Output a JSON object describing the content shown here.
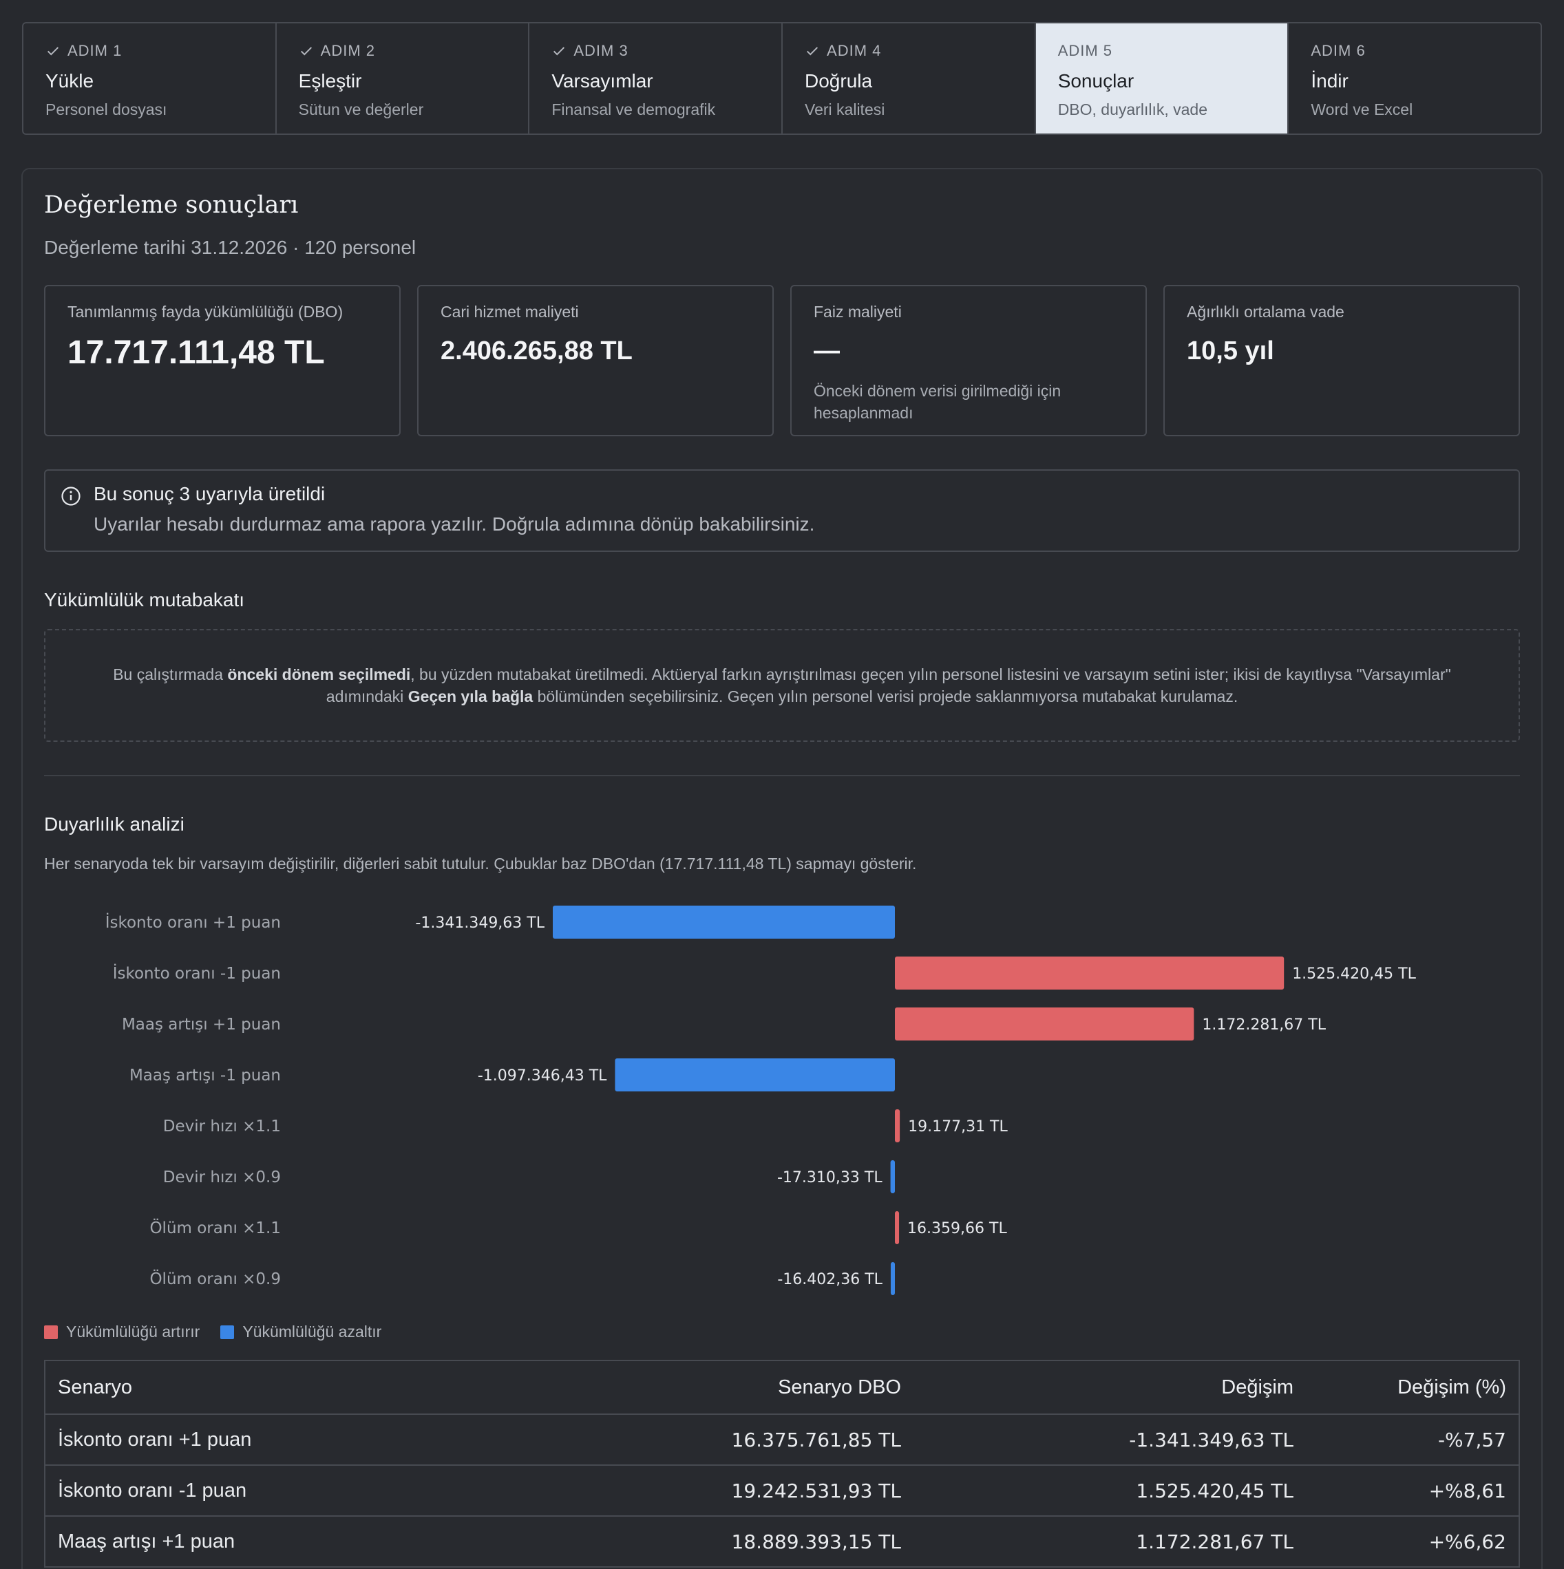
{
  "steps": [
    {
      "kicker": "ADIM 1",
      "title": "Yükle",
      "sub": "Personel dosyası",
      "done": true
    },
    {
      "kicker": "ADIM 2",
      "title": "Eşleştir",
      "sub": "Sütun ve değerler",
      "done": true
    },
    {
      "kicker": "ADIM 3",
      "title": "Varsayımlar",
      "sub": "Finansal ve demografik",
      "done": true
    },
    {
      "kicker": "ADIM 4",
      "title": "Doğrula",
      "sub": "Veri kalitesi",
      "done": true
    },
    {
      "kicker": "ADIM 5",
      "title": "Sonuçlar",
      "sub": "DBO, duyarlılık, vade",
      "done": false
    },
    {
      "kicker": "ADIM 6",
      "title": "İndir",
      "sub": "Word ve Excel",
      "done": false
    }
  ],
  "page": {
    "title": "Değerleme sonuçları",
    "meta": "Değerleme tarihi 31.12.2026 · 120 personel"
  },
  "stats": {
    "dbo": {
      "label": "Tanımlanmış fayda yükümlülüğü (DBO)",
      "value": "17.717.111,48 TL"
    },
    "service_cost": {
      "label": "Cari hizmet maliyeti",
      "value": "2.406.265,88 TL"
    },
    "interest_cost": {
      "label": "Faiz maliyeti",
      "value": "—",
      "note": "Önceki dönem verisi girilmediği için hesaplanmadı"
    },
    "duration": {
      "label": "Ağırlıklı ortalama vade",
      "value": "10,5 yıl"
    }
  },
  "warning": {
    "title": "Bu sonuç 3 uyarıyla üretildi",
    "detail": "Uyarılar hesabı durdurmaz ama rapora yazılır. Doğrula adımına dönüp bakabilirsiniz."
  },
  "reconciliation": {
    "title": "Yükümlülük mutabakatı",
    "text_1": "Bu çalıştırmada ",
    "bold_1": "önceki dönem seçilmedi",
    "text_2": ", bu yüzden mutabakat üretilmedi. Aktüeryal farkın ayrıştırılması geçen yılın personel listesini ve varsayım setini ister; ikisi de kayıtlıysa \"Varsayımlar\" adımındaki ",
    "bold_2": "Geçen yıla bağla",
    "text_3": " bölümünden seçebilirsiniz. Geçen yılın personel verisi projede saklanmıyorsa mutabakat kurulamaz."
  },
  "sensitivity": {
    "title": "Duyarlılık analizi",
    "description": "Her senaryoda tek bir varsayım değiştirilir, diğerleri sabit tutulur. Çubuklar baz DBO'dan (17.717.111,48 TL) sapmayı gösterir.",
    "legend": {
      "increase": "Yükümlülüğü artırır",
      "decrease": "Yükümlülüğü azaltır"
    },
    "colors": {
      "increase": "#e06467",
      "decrease": "#3a86e6"
    },
    "table_headers": {
      "scenario": "Senaryo",
      "dbo": "Senaryo DBO",
      "change": "Değişim",
      "pct": "Değişim (%)"
    },
    "rows": [
      {
        "scenario": "İskonto oranı +1 puan",
        "dbo": "16.375.761,85 TL",
        "change": "-1.341.349,63 TL",
        "pct": "-%7,57"
      },
      {
        "scenario": "İskonto oranı -1 puan",
        "dbo": "19.242.531,93 TL",
        "change": "1.525.420,45 TL",
        "pct": "+%8,61"
      },
      {
        "scenario": "Maaş artışı +1 puan",
        "dbo": "18.889.393,15 TL",
        "change": "1.172.281,67 TL",
        "pct": "+%6,62"
      }
    ]
  },
  "chart_data": {
    "type": "bar",
    "orientation": "horizontal",
    "categories": [
      "İskonto oranı +1 puan",
      "İskonto oranı -1 puan",
      "Maaş artışı +1 puan",
      "Maaş artışı -1 puan",
      "Devir hızı ×1.1",
      "Devir hızı ×0.9",
      "Ölüm oranı ×1.1",
      "Ölüm oranı ×0.9"
    ],
    "values": [
      -1341349.63,
      1525420.45,
      1172281.67,
      -1097346.43,
      19177.31,
      -17310.33,
      16359.66,
      -16402.36
    ],
    "value_labels": [
      "-1.341.349,63 TL",
      "1.525.420,45 TL",
      "1.172.281,67 TL",
      "-1.097.346,43 TL",
      "19.177,31 TL",
      "-17.310,33 TL",
      "16.359,66 TL",
      "-16.402,36 TL"
    ],
    "legend": [
      "Yükümlülüğü artırır",
      "Yükümlülüğü azaltır"
    ],
    "grid": false
  }
}
